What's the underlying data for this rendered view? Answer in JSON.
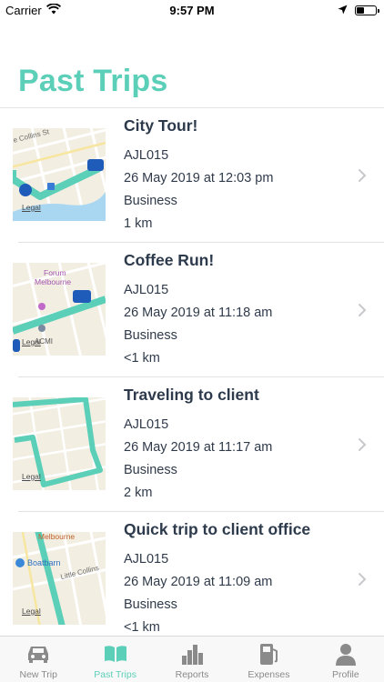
{
  "status_bar": {
    "carrier": "Carrier",
    "time": "9:57 PM"
  },
  "page": {
    "title": "Past Trips"
  },
  "map_labels": {
    "legal": "Legal"
  },
  "trips": [
    {
      "title": "City Tour!",
      "vehicle": "AJL015",
      "datetime": "26 May 2019 at 12:03 pm",
      "category": "Business",
      "distance": "1 km",
      "map_labels": [
        "e Collins St"
      ]
    },
    {
      "title": "Coffee Run!",
      "vehicle": "AJL015",
      "datetime": "26 May 2019 at 11:18 am",
      "category": "Business",
      "distance": "<1 km",
      "map_labels": [
        "Forum",
        "Melbourne",
        "ACMI"
      ]
    },
    {
      "title": "Traveling to client",
      "vehicle": "AJL015",
      "datetime": "26 May 2019 at 11:17 am",
      "category": "Business",
      "distance": "2 km",
      "map_labels": []
    },
    {
      "title": "Quick trip to client office",
      "vehicle": "AJL015",
      "datetime": "26 May 2019 at 11:09 am",
      "category": "Business",
      "distance": "<1 km",
      "map_labels": [
        "Melbourne",
        "Boatbarn",
        "Little Collins"
      ]
    }
  ],
  "tab_bar": {
    "tabs": [
      {
        "label": "New Trip",
        "icon": "car-icon",
        "active": false
      },
      {
        "label": "Past Trips",
        "icon": "book-icon",
        "active": true
      },
      {
        "label": "Reports",
        "icon": "bar-chart-icon",
        "active": false
      },
      {
        "label": "Expenses",
        "icon": "fuel-pump-icon",
        "active": false
      },
      {
        "label": "Profile",
        "icon": "person-icon",
        "active": false
      }
    ]
  },
  "colors": {
    "accent": "#5ccfb8",
    "text": "#2f3a4a",
    "route": "#5ccfb8",
    "tab_inactive": "#8a8a8a"
  }
}
